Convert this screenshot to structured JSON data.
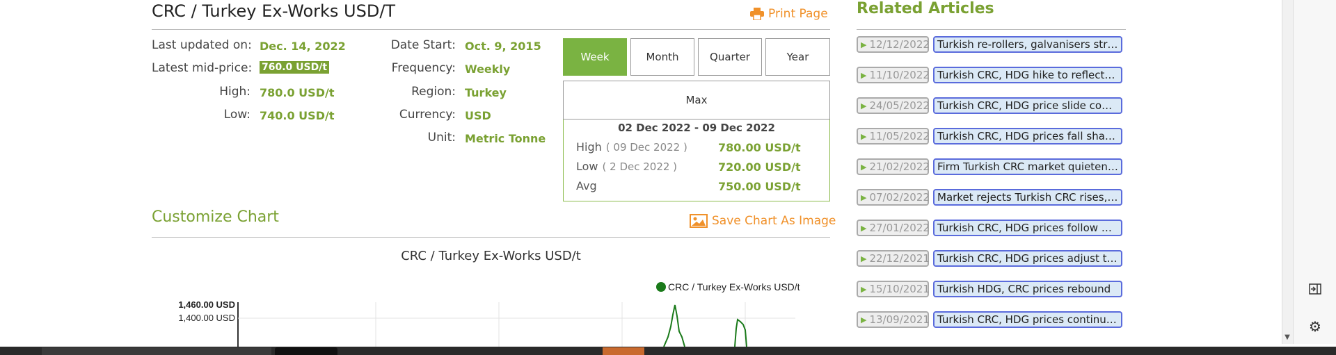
{
  "title": "CRC / Turkey Ex-Works USD/T",
  "print_label": "Print Page",
  "info_left": [
    {
      "label": "Last updated on:",
      "value": "Dec. 14, 2022",
      "highlight": false
    },
    {
      "label": "Latest mid-price:",
      "value": "760.0 USD/t",
      "highlight": true
    },
    {
      "label": "High:",
      "value": "780.0 USD/t",
      "highlight": false
    },
    {
      "label": "Low:",
      "value": "740.0 USD/t",
      "highlight": false
    }
  ],
  "info_mid": [
    {
      "label": "Date Start:",
      "value": "Oct. 9, 2015"
    },
    {
      "label": "Frequency:",
      "value": "Weekly"
    },
    {
      "label": "Region:",
      "value": "Turkey"
    },
    {
      "label": "Currency:",
      "value": "USD"
    },
    {
      "label": "Unit:",
      "value": "Metric Tonne"
    }
  ],
  "range_buttons": {
    "week": "Week",
    "month": "Month",
    "quarter": "Quarter",
    "year": "Year",
    "max": "Max",
    "active": "week"
  },
  "stats": {
    "range": "02 Dec 2022 - 09 Dec 2022",
    "high_label": "High",
    "high_date": "( 09 Dec 2022 )",
    "high_value": "780.00 USD/t",
    "low_label": "Low",
    "low_date": "( 2 Dec 2022 )",
    "low_value": "720.00 USD/t",
    "avg_label": "Avg",
    "avg_value": "750.00 USD/t"
  },
  "customize_title": "Customize Chart",
  "save_chart_label": "Save Chart As Image",
  "chart_title": "CRC / Turkey Ex-Works USD/t",
  "chart_data": {
    "type": "line",
    "series": [
      {
        "name": "CRC / Turkey Ex-Works USD/t",
        "color": "#1a7a1a"
      }
    ],
    "y_ticks": [
      "1,460.00 USD",
      "1,400.00 USD"
    ],
    "legend": "top-right"
  },
  "related_title": "Related Articles",
  "related": [
    {
      "date": "12/12/2022",
      "title": "Turkish re-rollers, galvanisers striv..."
    },
    {
      "date": "11/10/2022",
      "title": "Turkish CRC, HDG hike to reflect hi..."
    },
    {
      "date": "24/05/2022",
      "title": "Turkish CRC, HDG price slide conti..."
    },
    {
      "date": "11/05/2022",
      "title": "Turkish CRC, HDG prices fall sharpl..."
    },
    {
      "date": "21/02/2022",
      "title": "Firm Turkish CRC market quietens,..."
    },
    {
      "date": "07/02/2022",
      "title": "Market rejects Turkish CRC rises, H..."
    },
    {
      "date": "27/01/2022",
      "title": "Turkish CRC, HDG prices follow HR..."
    },
    {
      "date": "22/12/2021",
      "title": "Turkish CRC, HDG prices adjust to ..."
    },
    {
      "date": "15/10/2021",
      "title": "Turkish HDG, CRC prices rebound"
    },
    {
      "date": "13/09/2021",
      "title": "Turkish CRC, HDG prices continue ..."
    }
  ],
  "colors": {
    "accent_green": "#7aa132",
    "orange": "#f0912a",
    "link_border": "#5a6bdc"
  }
}
